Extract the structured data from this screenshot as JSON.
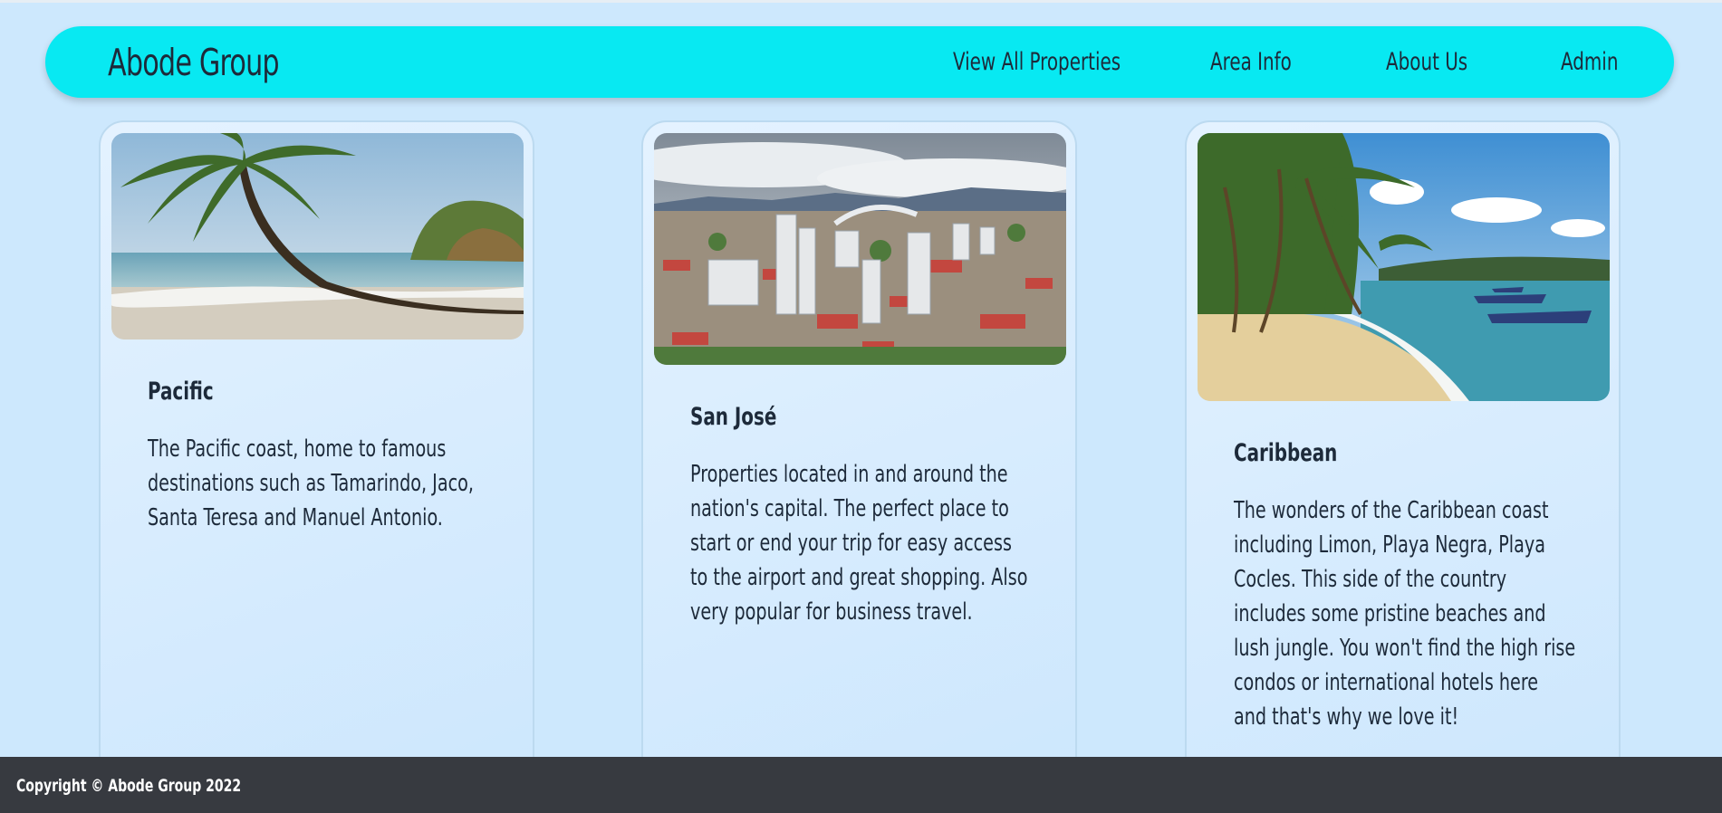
{
  "header": {
    "brand": "Abode Group",
    "nav": [
      {
        "label": "View All Properties"
      },
      {
        "label": "Area Info"
      },
      {
        "label": "About Us"
      },
      {
        "label": "Admin"
      }
    ]
  },
  "cards": [
    {
      "title": "Pacific",
      "text": "The Pacific coast, home to famous destinations such as Tamarindo, Jaco, Santa Teresa and Manuel Antonio.",
      "image": "beach-with-palm-tree"
    },
    {
      "title": "San José",
      "text": "Properties located in and around the nation's capital. The perfect place to start or end your trip for easy access to the airport and great shopping. Also very popular for business travel.",
      "image": "city-skyline"
    },
    {
      "title": "Caribbean",
      "text": "The wonders of the Caribbean coast including Limon, Playa Negra, Playa Cocles. This side of the country includes some pristine beaches and lush jungle. You won't find the high rise condos or international hotels here and that's why we love it!",
      "image": "caribbean-beach-boats"
    }
  ],
  "footer": {
    "copyright": "Copyright © Abode Group 2022"
  },
  "colors": {
    "page_bg": "#cde8fd",
    "navbar_bg": "#08e9f2",
    "footer_bg": "#373a40",
    "text": "#1d2a3a"
  }
}
